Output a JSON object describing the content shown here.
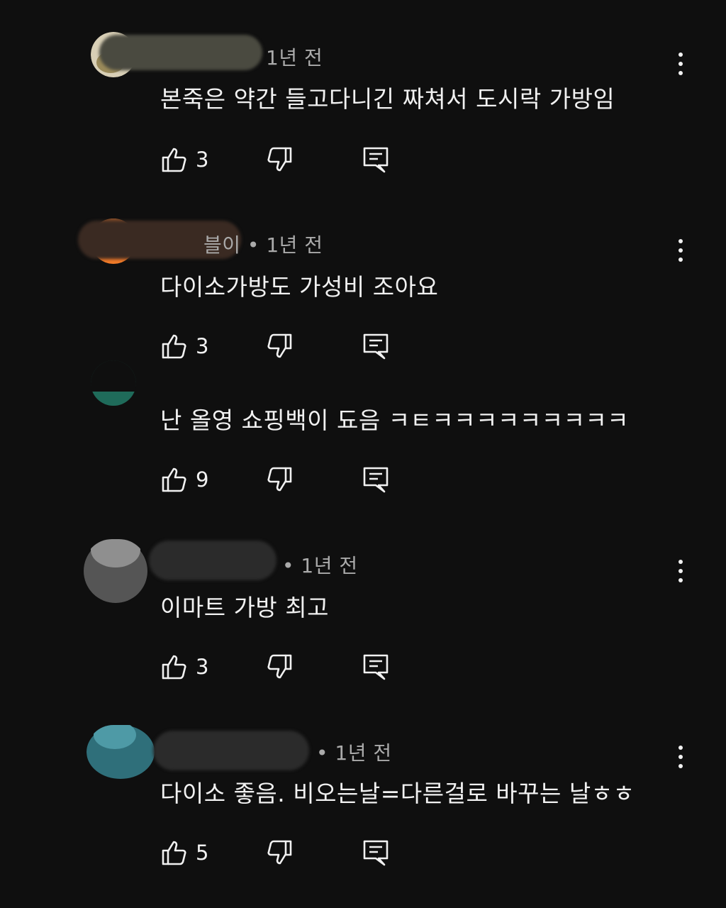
{
  "comments": [
    {
      "meta": "1년 전",
      "text": "본죽은 약간 들고다니긴 짜쳐서 도시락 가방임",
      "likes": "3"
    },
    {
      "meta": "블이 • 1년 전",
      "text": "다이소가방도 가성비 조아요",
      "likes": "3"
    },
    {
      "meta": "",
      "text": "난 올영 쇼핑백이 됴음 ㅋㅌㅋㅋㅋㅋㅋㅋㅋㅋㅋ",
      "likes": "9"
    },
    {
      "meta": "• 1년 전",
      "text": "이마트 가방 최고",
      "likes": "3"
    },
    {
      "meta": "• 1년 전",
      "text": "다이소 좋음. 비오는날=다른걸로 바꾸는 날ㅎㅎ",
      "likes": "5"
    }
  ],
  "icons": {
    "like": "thumbs-up-icon",
    "dislike": "thumbs-down-icon",
    "reply": "reply-icon",
    "more": "more-vertical-icon"
  },
  "colors": {
    "background": "#0f0f0f",
    "text": "#f1f1f1",
    "meta": "#aaaaaa"
  }
}
